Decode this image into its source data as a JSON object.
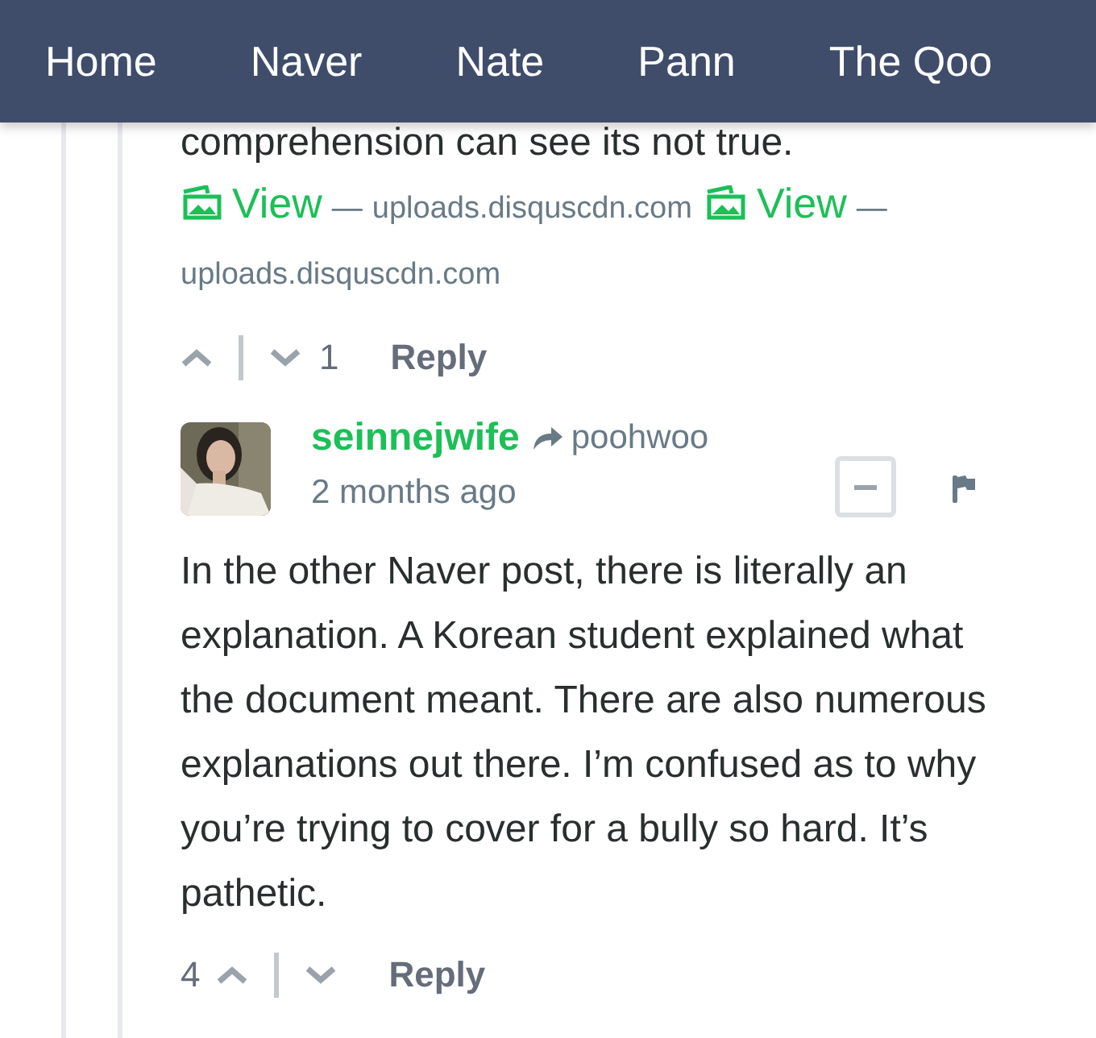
{
  "nav": {
    "items": [
      {
        "label": "Home"
      },
      {
        "label": "Naver"
      },
      {
        "label": "Nate"
      },
      {
        "label": "Pann"
      },
      {
        "label": "The Qoo"
      }
    ]
  },
  "previous_comment": {
    "text_tail": "comprehension can see its not true.",
    "attachments": [
      {
        "link": "View",
        "separator": "—",
        "source": "uploads.disquscdn.com"
      },
      {
        "link": "View",
        "separator": "—",
        "source": "uploads.disquscdn.com"
      }
    ],
    "votes": {
      "downvotes": "1"
    },
    "reply": "Reply"
  },
  "comment": {
    "author": "seinnejwife",
    "in_reply_to": "poohwoo",
    "time": "2 months ago",
    "text": "In the other Naver post, there is literally an explanation. A Korean student explained what the document meant. There are also numerous explanations out there. I’m confused as to why you’re trying to cover for a bully so hard. It’s pathetic.",
    "votes": {
      "upvotes": "4"
    },
    "reply": "Reply"
  }
}
